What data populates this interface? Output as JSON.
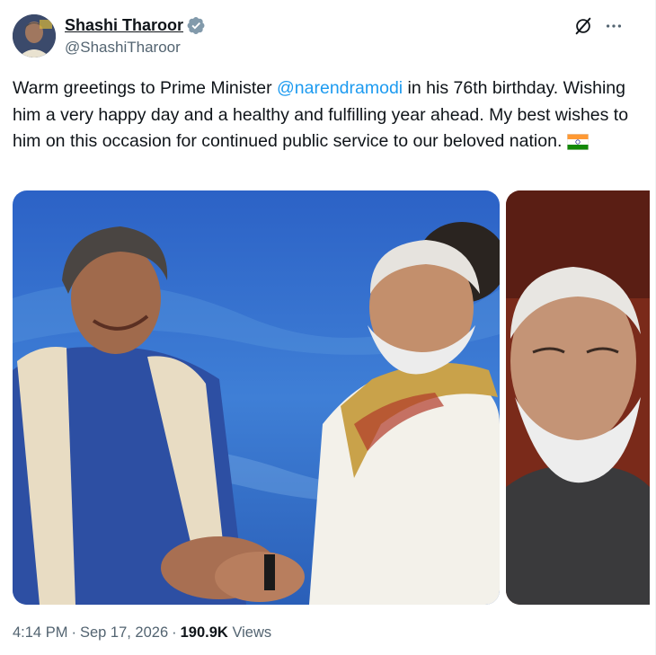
{
  "author": {
    "display_name": "Shashi Tharoor",
    "handle": "@ShashiTharoor",
    "verified": true,
    "avatar_icon": "profile-avatar"
  },
  "header_actions": {
    "grok_icon": "grok-icon",
    "more_icon": "more-dots-icon"
  },
  "tweet": {
    "text_before": "Warm greetings to Prime Minister ",
    "mention": "@narendramodi",
    "text_after": " in his 76th birthday. Wishing him a very happy day and a healthy and fulfilling year ahead. My best wishes to him on this occasion for continued public service to our beloved nation.",
    "flag_icon": "india-flag-emoji"
  },
  "media": {
    "photo_count": 2
  },
  "meta": {
    "time": "4:14 PM",
    "date": "Sep 17, 2026",
    "views_count": "190.9K",
    "views_label": "Views"
  },
  "colors": {
    "text": "#0f1419",
    "secondary": "#536471",
    "link": "#1d9bf0",
    "verified_badge": "#829aab"
  }
}
